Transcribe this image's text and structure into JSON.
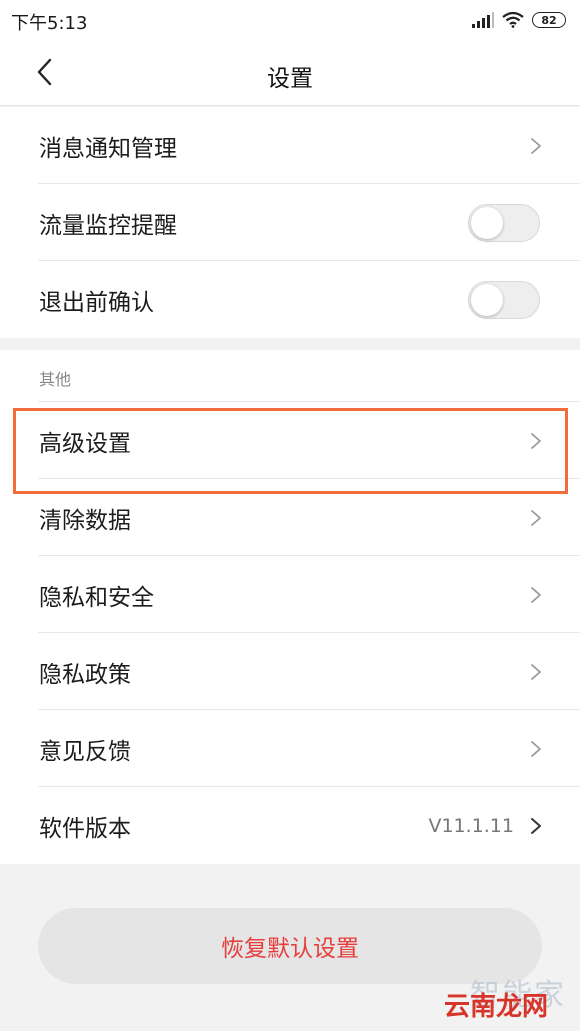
{
  "status_bar": {
    "time": "下午5:13",
    "battery": "82"
  },
  "header": {
    "title": "设置"
  },
  "section1": {
    "items": [
      {
        "label": "消息通知管理"
      },
      {
        "label": "流量监控提醒",
        "toggle_on": false
      },
      {
        "label": "退出前确认",
        "toggle_on": false
      }
    ]
  },
  "section2": {
    "group_label": "其他",
    "items": [
      {
        "label": "高级设置"
      },
      {
        "label": "清除数据"
      },
      {
        "label": "隐私和安全"
      },
      {
        "label": "隐私政策"
      },
      {
        "label": "意见反馈"
      },
      {
        "label": "软件版本",
        "value": "V11.1.11"
      }
    ]
  },
  "reset_button": {
    "label": "恢复默认设置"
  },
  "watermark": {
    "line1": "智能家",
    "line2": "云南龙网"
  },
  "colors": {
    "accent_red": "#e83d3d",
    "highlight_orange": "#f26b3a"
  }
}
